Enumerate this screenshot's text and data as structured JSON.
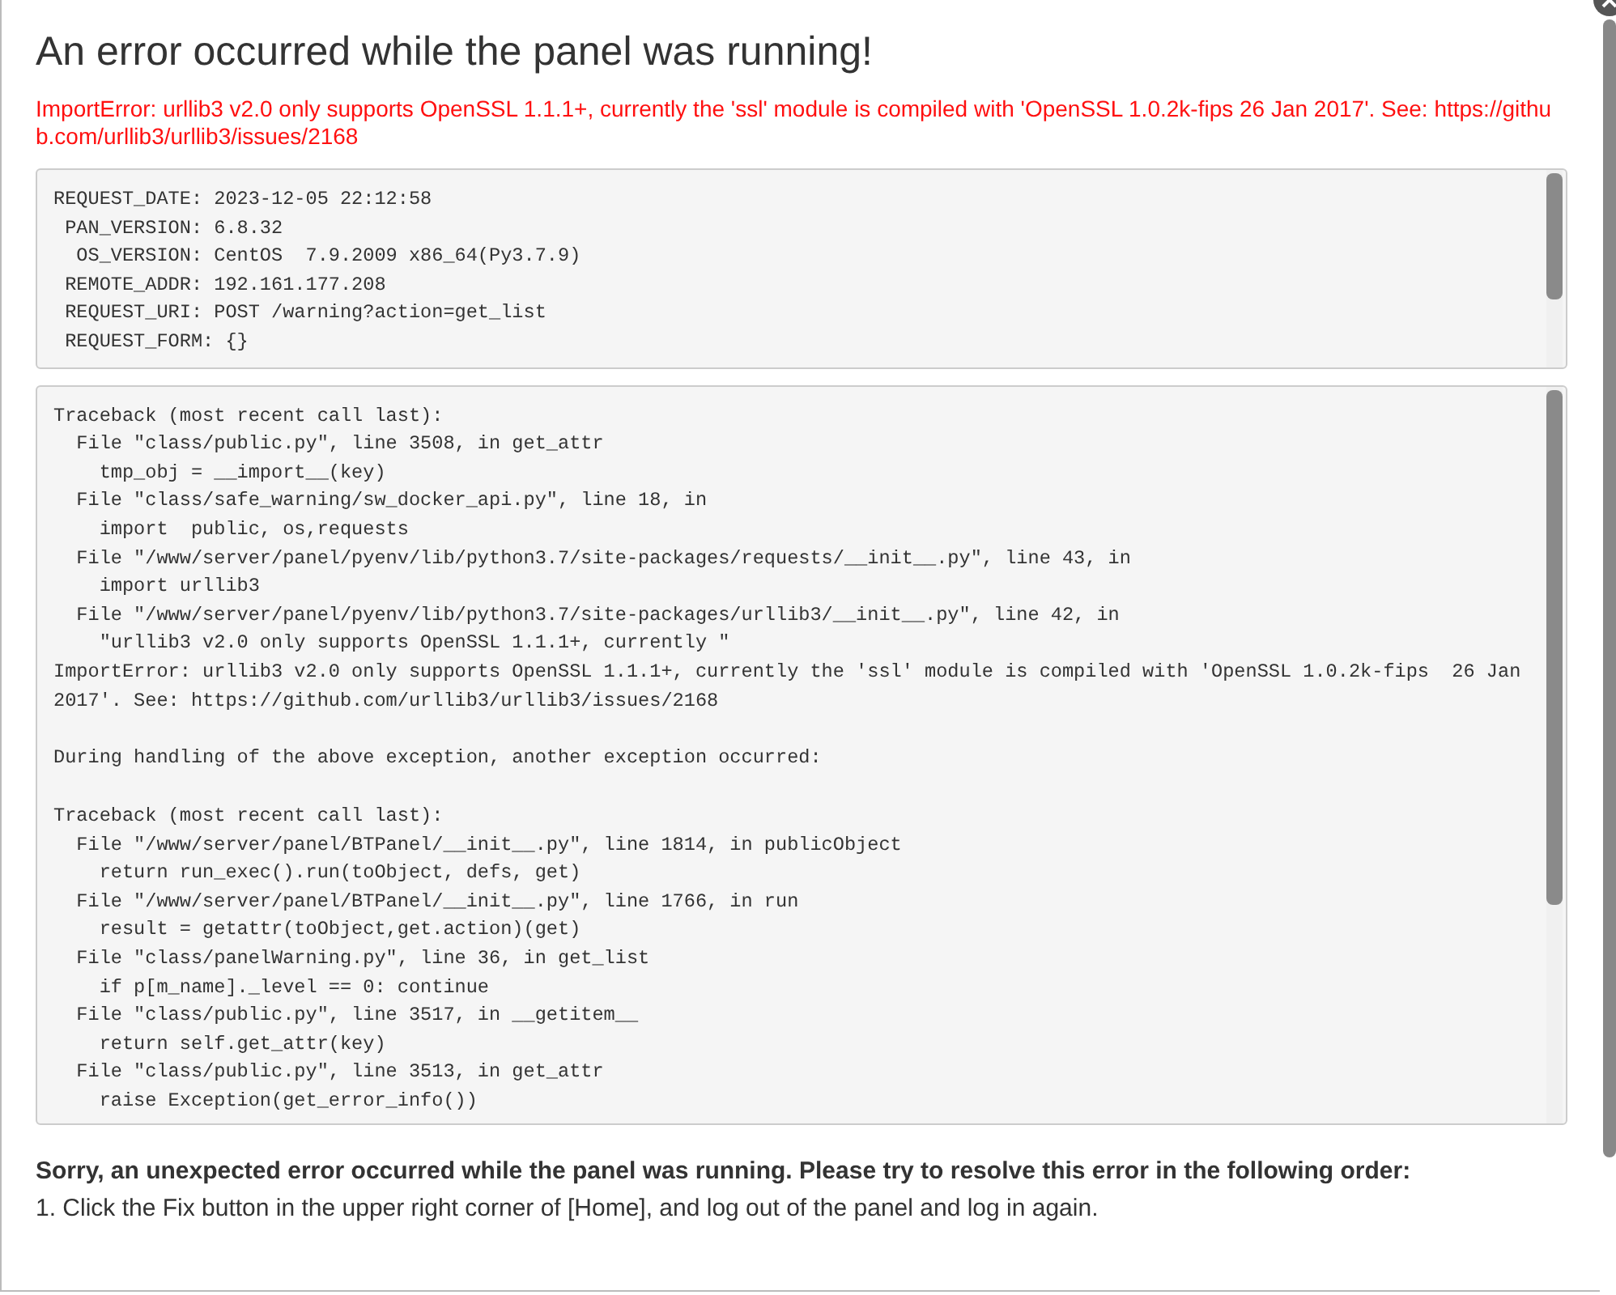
{
  "dialog": {
    "title": "An error occurred while the panel was running!",
    "error_message": "ImportError: urllib3 v2.0 only supports OpenSSL 1.1.1+, currently the 'ssl' module is compiled with 'OpenSSL 1.0.2k-fips 26 Jan 2017'. See: https://github.com/urllib3/urllib3/issues/2168",
    "request_info": [
      "REQUEST_DATE: 2023-12-05 22:12:58",
      " PAN_VERSION: 6.8.32",
      "  OS_VERSION: CentOS  7.9.2009 x86_64(Py3.7.9)",
      " REMOTE_ADDR: 192.161.177.208",
      " REQUEST_URI: POST /warning?action=get_list",
      " REQUEST_FORM: {}"
    ],
    "traceback": [
      [
        "Traceback (most recent call last):",
        "  File \"class/public.py\", line 3508, in get_attr",
        "    tmp_obj = __import__(key)",
        "  File \"class/safe_warning/sw_docker_api.py\", line 18, in",
        "    import  public, os,requests",
        "  File \"/www/server/panel/pyenv/lib/python3.7/site-packages/requests/__init__.py\", line 43, in",
        "    import urllib3",
        "  File \"/www/server/panel/pyenv/lib/python3.7/site-packages/urllib3/__init__.py\", line 42, in",
        "    \"urllib3 v2.0 only supports OpenSSL 1.1.1+, currently \"",
        "ImportError: urllib3 v2.0 only supports OpenSSL 1.1.1+, currently the 'ssl' module is compiled with 'OpenSSL 1.0.2k-fips  26 Jan",
        "2017'. See: https://github.com/urllib3/urllib3/issues/2168"
      ],
      [
        "During handling of the above exception, another exception occurred:"
      ],
      [
        "Traceback (most recent call last):",
        "  File \"/www/server/panel/BTPanel/__init__.py\", line 1814, in publicObject",
        "    return run_exec().run(toObject, defs, get)",
        "  File \"/www/server/panel/BTPanel/__init__.py\", line 1766, in run",
        "    result = getattr(toObject,get.action)(get)",
        "  File \"class/panelWarning.py\", line 36, in get_list",
        "    if p[m_name]._level == 0: continue",
        "  File \"class/public.py\", line 3517, in __getitem__",
        "    return self.get_attr(key)",
        "  File \"class/public.py\", line 3513, in get_attr",
        "    raise Exception(get_error_info())"
      ]
    ],
    "advice": {
      "heading": "Sorry, an unexpected error occurred while the panel was running. Please try to resolve this error in the following order:",
      "steps": [
        "1. Click the Fix button in the upper right corner of [Home], and log out of the panel and log in again."
      ]
    }
  }
}
